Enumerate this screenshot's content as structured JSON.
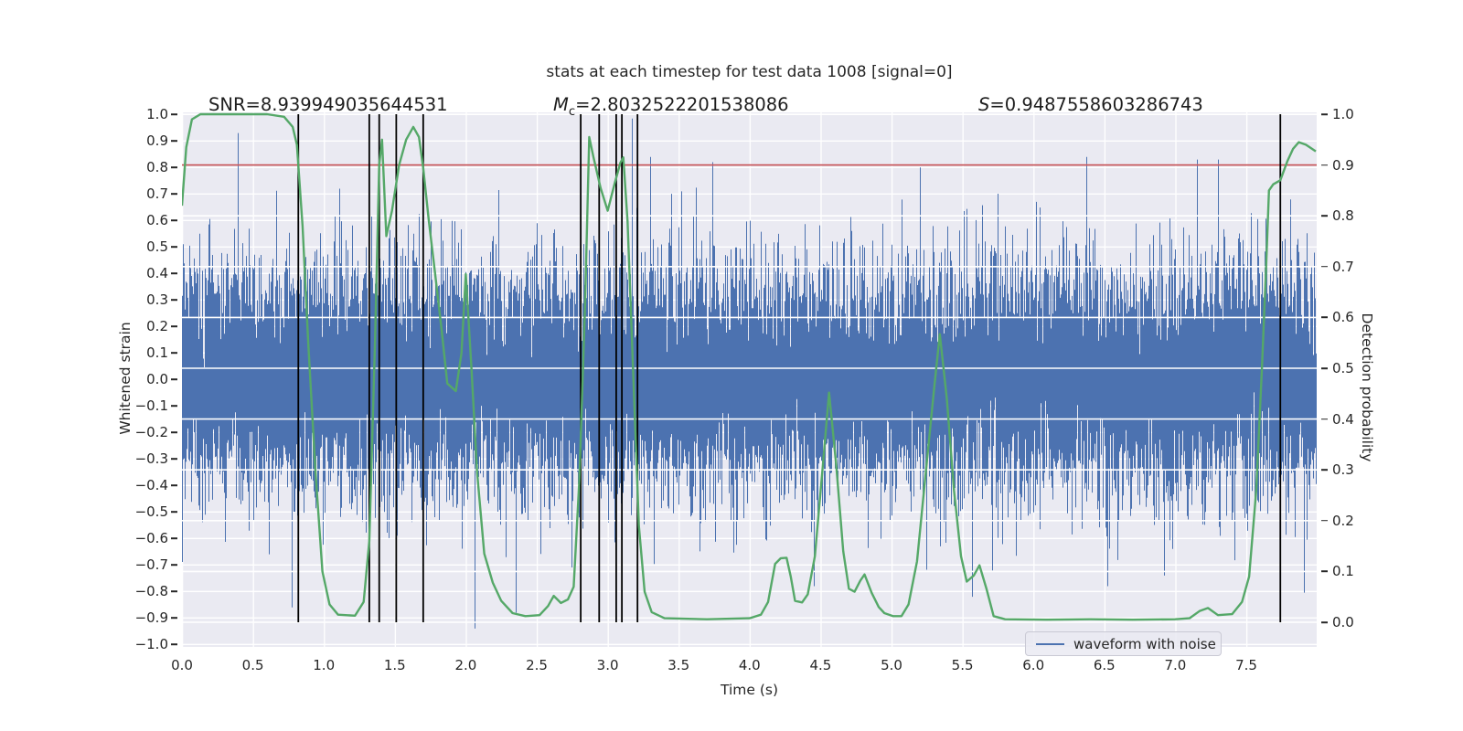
{
  "title": "stats at each timestep for test data 1008 [signal=0]",
  "annotations": {
    "snr": "SNR=8.939949035644531",
    "mc_symbol": "M",
    "mc_subscript": "c",
    "mc_value": "=2.8032522201538086",
    "s_symbol": "S",
    "s_value": "=0.9487558603286743"
  },
  "legend": {
    "label": "waveform with noise"
  },
  "colors": {
    "waveform_blue": "#4c72b0",
    "detection_green": "#55a868",
    "threshold_red": "#c44e52",
    "event_black": "#000000",
    "plot_background": "#eaeaf2",
    "grid": "#ffffff",
    "text": "#262626"
  },
  "chart_data": {
    "type": "line",
    "title": "stats at each timestep for test data 1008 [signal=0]",
    "x_axis": {
      "label": "Time (s)",
      "range": [
        0,
        8
      ],
      "tick_labels": [
        "0.0",
        "0.5",
        "1.0",
        "1.5",
        "2.0",
        "2.5",
        "3.0",
        "3.5",
        "4.0",
        "4.5",
        "5.0",
        "5.5",
        "6.0",
        "6.5",
        "7.0",
        "7.5"
      ]
    },
    "left_axis": {
      "label": "Whitened strain",
      "range": [
        -1.0,
        1.0
      ],
      "tick_labels": [
        "1.0",
        "0.9",
        "0.8",
        "0.7",
        "0.6",
        "0.5",
        "0.4",
        "0.3",
        "0.2",
        "0.1",
        "0.0",
        "−0.1",
        "−0.2",
        "−0.3",
        "−0.4",
        "−0.5",
        "−0.6",
        "−0.7",
        "−0.8",
        "−0.9",
        "−1.0"
      ]
    },
    "right_axis": {
      "label": "Detection probability",
      "range": [
        0.0,
        1.0
      ],
      "tick_labels": [
        "1.0",
        "0.9",
        "0.8",
        "0.7",
        "0.6",
        "0.5",
        "0.4",
        "0.3",
        "0.2",
        "0.1",
        "0.0"
      ]
    },
    "grid": true,
    "legend_position": "lower right",
    "threshold_line": {
      "axis": "right",
      "value": 0.9,
      "color": "#c44e52"
    },
    "event_lines": {
      "color": "#000000",
      "times": [
        0.82,
        1.32,
        1.39,
        1.51,
        1.7,
        2.81,
        2.94,
        3.06,
        3.1,
        3.21,
        7.74
      ]
    },
    "detection_probability_curve": {
      "color": "#55a868",
      "points": [
        [
          0.0,
          0.82
        ],
        [
          0.03,
          0.935
        ],
        [
          0.07,
          0.99
        ],
        [
          0.13,
          1.0
        ],
        [
          0.35,
          1.0
        ],
        [
          0.6,
          1.0
        ],
        [
          0.72,
          0.995
        ],
        [
          0.78,
          0.975
        ],
        [
          0.81,
          0.94
        ],
        [
          0.85,
          0.78
        ],
        [
          0.89,
          0.55
        ],
        [
          0.94,
          0.3
        ],
        [
          0.99,
          0.1
        ],
        [
          1.04,
          0.035
        ],
        [
          1.1,
          0.015
        ],
        [
          1.22,
          0.013
        ],
        [
          1.28,
          0.04
        ],
        [
          1.32,
          0.16
        ],
        [
          1.36,
          0.55
        ],
        [
          1.39,
          0.9
        ],
        [
          1.41,
          0.95
        ],
        [
          1.44,
          0.76
        ],
        [
          1.48,
          0.81
        ],
        [
          1.53,
          0.9
        ],
        [
          1.58,
          0.95
        ],
        [
          1.63,
          0.975
        ],
        [
          1.67,
          0.955
        ],
        [
          1.7,
          0.895
        ],
        [
          1.74,
          0.79
        ],
        [
          1.78,
          0.695
        ],
        [
          1.83,
          0.575
        ],
        [
          1.87,
          0.47
        ],
        [
          1.93,
          0.455
        ],
        [
          1.97,
          0.53
        ],
        [
          2.0,
          0.685
        ],
        [
          2.04,
          0.5
        ],
        [
          2.08,
          0.295
        ],
        [
          2.13,
          0.135
        ],
        [
          2.19,
          0.078
        ],
        [
          2.25,
          0.042
        ],
        [
          2.33,
          0.018
        ],
        [
          2.42,
          0.012
        ],
        [
          2.52,
          0.014
        ],
        [
          2.58,
          0.032
        ],
        [
          2.62,
          0.052
        ],
        [
          2.67,
          0.038
        ],
        [
          2.72,
          0.045
        ],
        [
          2.76,
          0.07
        ],
        [
          2.8,
          0.28
        ],
        [
          2.84,
          0.62
        ],
        [
          2.87,
          0.955
        ],
        [
          2.9,
          0.915
        ],
        [
          2.95,
          0.855
        ],
        [
          3.0,
          0.81
        ],
        [
          3.05,
          0.865
        ],
        [
          3.09,
          0.905
        ],
        [
          3.11,
          0.915
        ],
        [
          3.14,
          0.79
        ],
        [
          3.18,
          0.49
        ],
        [
          3.22,
          0.19
        ],
        [
          3.26,
          0.06
        ],
        [
          3.31,
          0.02
        ],
        [
          3.4,
          0.008
        ],
        [
          3.7,
          0.006
        ],
        [
          4.0,
          0.008
        ],
        [
          4.08,
          0.015
        ],
        [
          4.13,
          0.04
        ],
        [
          4.18,
          0.115
        ],
        [
          4.22,
          0.126
        ],
        [
          4.26,
          0.127
        ],
        [
          4.29,
          0.09
        ],
        [
          4.32,
          0.042
        ],
        [
          4.37,
          0.039
        ],
        [
          4.41,
          0.055
        ],
        [
          4.46,
          0.13
        ],
        [
          4.51,
          0.29
        ],
        [
          4.56,
          0.452
        ],
        [
          4.61,
          0.31
        ],
        [
          4.66,
          0.14
        ],
        [
          4.7,
          0.066
        ],
        [
          4.74,
          0.06
        ],
        [
          4.78,
          0.082
        ],
        [
          4.81,
          0.094
        ],
        [
          4.86,
          0.058
        ],
        [
          4.91,
          0.03
        ],
        [
          4.95,
          0.018
        ],
        [
          5.01,
          0.012
        ],
        [
          5.07,
          0.012
        ],
        [
          5.12,
          0.035
        ],
        [
          5.18,
          0.12
        ],
        [
          5.24,
          0.29
        ],
        [
          5.3,
          0.46
        ],
        [
          5.34,
          0.567
        ],
        [
          5.39,
          0.44
        ],
        [
          5.44,
          0.26
        ],
        [
          5.49,
          0.13
        ],
        [
          5.53,
          0.08
        ],
        [
          5.58,
          0.092
        ],
        [
          5.62,
          0.112
        ],
        [
          5.67,
          0.065
        ],
        [
          5.72,
          0.012
        ],
        [
          5.8,
          0.006
        ],
        [
          6.1,
          0.005
        ],
        [
          6.4,
          0.006
        ],
        [
          6.7,
          0.005
        ],
        [
          7.0,
          0.006
        ],
        [
          7.1,
          0.008
        ],
        [
          7.17,
          0.022
        ],
        [
          7.23,
          0.028
        ],
        [
          7.3,
          0.014
        ],
        [
          7.4,
          0.016
        ],
        [
          7.47,
          0.04
        ],
        [
          7.52,
          0.09
        ],
        [
          7.57,
          0.26
        ],
        [
          7.61,
          0.5
        ],
        [
          7.64,
          0.7
        ],
        [
          7.66,
          0.85
        ],
        [
          7.69,
          0.862
        ],
        [
          7.74,
          0.87
        ],
        [
          7.79,
          0.908
        ],
        [
          7.83,
          0.932
        ],
        [
          7.87,
          0.945
        ],
        [
          7.92,
          0.94
        ],
        [
          7.99,
          0.927
        ]
      ]
    },
    "noise_waveform": {
      "label": "waveform with noise",
      "color": "#4c72b0",
      "stddev": 0.21,
      "samples_per_column": 13,
      "seed": 42,
      "spike_events": [
        [
          0.39,
          0.93
        ],
        [
          0.77,
          -0.86
        ],
        [
          1.11,
          0.72
        ],
        [
          2.06,
          -0.94
        ],
        [
          2.35,
          -0.88
        ],
        [
          3.17,
          0.985
        ],
        [
          3.3,
          0.84
        ],
        [
          3.74,
          0.82
        ],
        [
          4.45,
          -0.78
        ],
        [
          5.2,
          0.8
        ],
        [
          5.57,
          -0.82
        ],
        [
          6.37,
          0.84
        ],
        [
          6.52,
          -0.78
        ],
        [
          6.92,
          -0.74
        ],
        [
          7.15,
          0.83
        ],
        [
          7.3,
          0.83
        ]
      ]
    }
  }
}
